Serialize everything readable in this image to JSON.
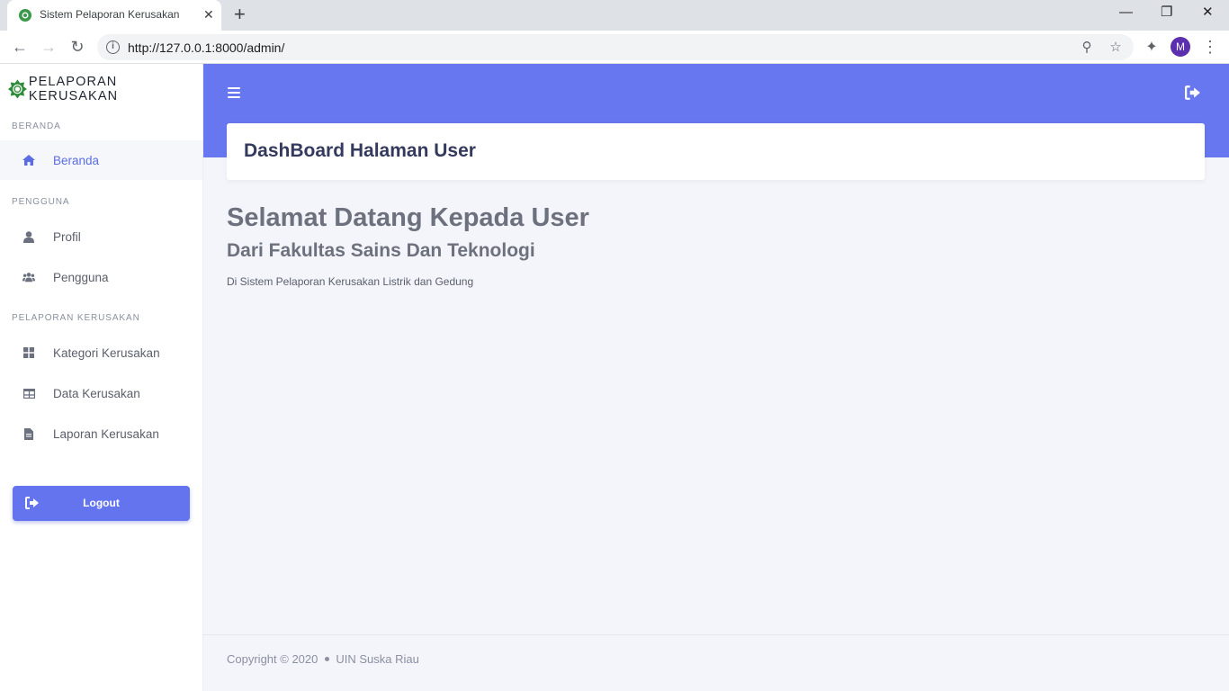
{
  "browser": {
    "tab_title": "Sistem Pelaporan Kerusakan",
    "tab_close": "✕",
    "new_tab": "+",
    "url": "http://127.0.0.1:8000/admin/",
    "profile_initial": "M",
    "window_controls": {
      "minimize": "—",
      "restore": "❐",
      "close": "✕"
    }
  },
  "sidebar": {
    "brand": "PELAPORAN KERUSAKAN",
    "sections": [
      {
        "label": "BERANDA",
        "items": [
          {
            "label": "Beranda",
            "icon": "home-icon",
            "active": true
          }
        ]
      },
      {
        "label": "PENGGUNA",
        "items": [
          {
            "label": "Profil",
            "icon": "user-icon"
          },
          {
            "label": "Pengguna",
            "icon": "users-icon"
          }
        ]
      },
      {
        "label": "PELAPORAN KERUSAKAN",
        "items": [
          {
            "label": "Kategori Kerusakan",
            "icon": "grid-icon"
          },
          {
            "label": "Data Kerusakan",
            "icon": "table-icon"
          },
          {
            "label": "Laporan Kerusakan",
            "icon": "file-icon"
          }
        ]
      }
    ],
    "logout_label": "Logout"
  },
  "header": {
    "title": "DashBoard Halaman User"
  },
  "main": {
    "heading": "Selamat Datang Kepada User",
    "subheading": "Dari Fakultas Sains Dan Teknologi",
    "description": "Di Sistem Pelaporan Kerusakan Listrik dan Gedung"
  },
  "footer": {
    "copyright": "Copyright © 2020",
    "org": "UIN Suska Riau"
  },
  "colors": {
    "primary": "#6777ef",
    "active_text": "#5a6de3",
    "heading": "#34395e",
    "muted": "#6c717d"
  }
}
